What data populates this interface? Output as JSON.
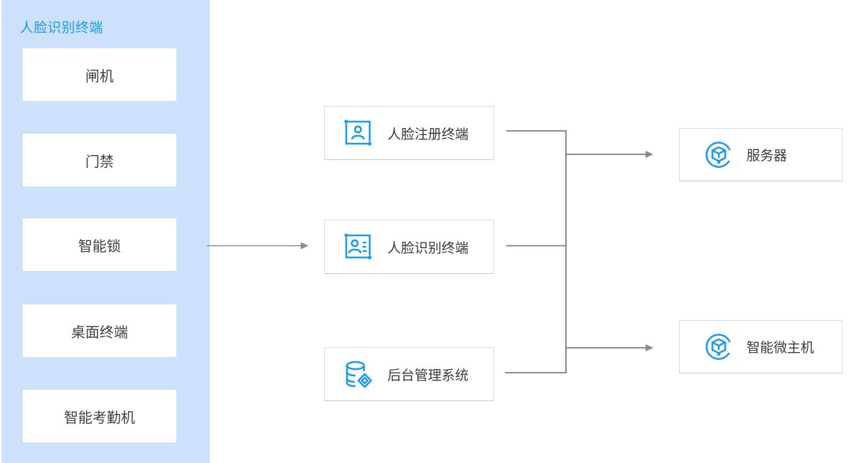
{
  "diagram": {
    "terminal_group": {
      "title": "人脸识别终端",
      "devices": [
        {
          "label": "闸机"
        },
        {
          "label": "门禁"
        },
        {
          "label": "智能锁"
        },
        {
          "label": "桌面终端"
        },
        {
          "label": "智能考勤机"
        }
      ]
    },
    "middle_nodes": [
      {
        "label": "人脸注册终端",
        "icon": "face-register-icon"
      },
      {
        "label": "人脸识别终端",
        "icon": "face-recognition-icon"
      },
      {
        "label": "后台管理系统",
        "icon": "database-management-icon"
      }
    ],
    "right_nodes": [
      {
        "label": "服务器",
        "icon": "server-cube-icon"
      },
      {
        "label": "智能微主机",
        "icon": "micro-host-cube-icon"
      }
    ],
    "connections": [
      {
        "from": "人脸识别终端(group)",
        "to": "人脸识别终端"
      },
      {
        "from": "人脸注册终端",
        "to": "bus"
      },
      {
        "from": "人脸识别终端",
        "to": "bus"
      },
      {
        "from": "后台管理系统",
        "to": "bus"
      },
      {
        "from": "bus",
        "to": "服务器"
      },
      {
        "from": "bus",
        "to": "智能微主机"
      }
    ],
    "colors": {
      "accent": "#1a9bf0",
      "panel_bg": "#cde1fd",
      "line": "#8c8c8c",
      "text": "#3a3a3a"
    }
  }
}
